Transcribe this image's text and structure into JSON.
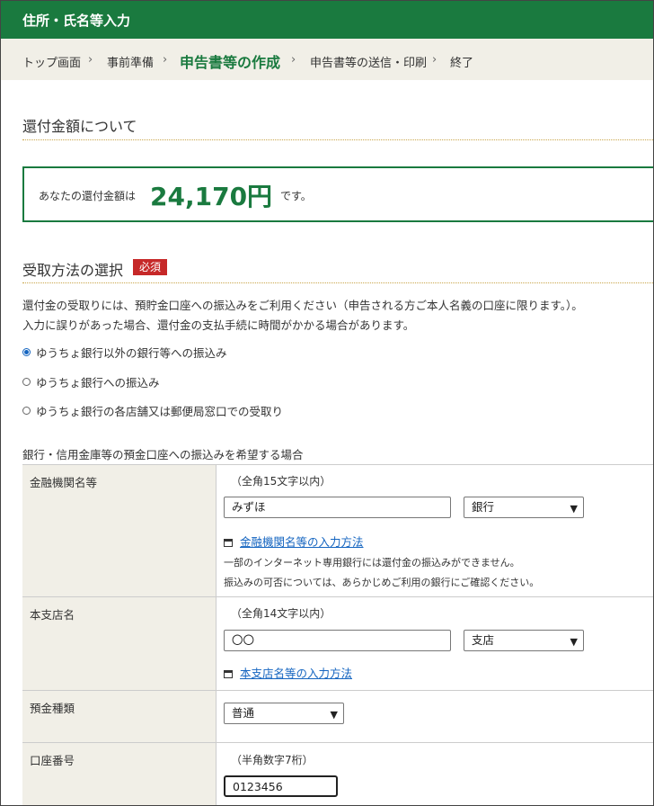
{
  "header": {
    "title": "住所・氏名等入力"
  },
  "steps": {
    "items": [
      "トップ画面",
      "事前準備",
      "申告書等の作成",
      "申告書等の送信・印刷",
      "終了"
    ],
    "separator": "›"
  },
  "refund": {
    "heading": "還付金額について",
    "prefix": "あなたの還付金額は",
    "amount": "24,170円",
    "suffix": "です。"
  },
  "method": {
    "heading": "受取方法の選択",
    "required_badge": "必須",
    "desc1": "還付金の受取りには、預貯金口座への振込みをご利用ください（申告される方ご本人名義の口座に限ります。）。",
    "desc2": "入力に誤りがあった場合、還付金の支払手続に時間がかかる場合があります。",
    "options": [
      {
        "label": "ゆうちょ銀行以外の銀行等への振込み",
        "selected": true
      },
      {
        "label": "ゆうちょ銀行への振込み",
        "selected": false
      },
      {
        "label": "ゆうちょ銀行の各店舗又は郵便局窓口での受取り",
        "selected": false
      }
    ]
  },
  "bank_form": {
    "caption": "銀行・信用金庫等の預金口座への振込みを希望する場合",
    "institution": {
      "label": "金融機関名等",
      "hint": "（全角15文字以内）",
      "value": "みずほ",
      "type_value": "銀行",
      "help_link": "金融機関名等の入力方法",
      "note1": "一部のインターネット専用銀行には還付金の振込みができません。",
      "note2": "振込みの可否については、あらかじめご利用の銀行にご確認ください。"
    },
    "branch": {
      "label": "本支店名",
      "hint": "（全角14文字以内）",
      "value": "〇〇",
      "type_value": "支店",
      "help_link": "本支店名等の入力方法"
    },
    "deposit_type": {
      "label": "預金種類",
      "value": "普通"
    },
    "account_number": {
      "label": "口座番号",
      "hint": "（半角数字7桁）",
      "value": "0123456"
    }
  },
  "colors": {
    "brand_green": "#1a7a3f",
    "required_red": "#c62828",
    "link_blue": "#1565c0",
    "label_bg": "#f1efe7"
  }
}
